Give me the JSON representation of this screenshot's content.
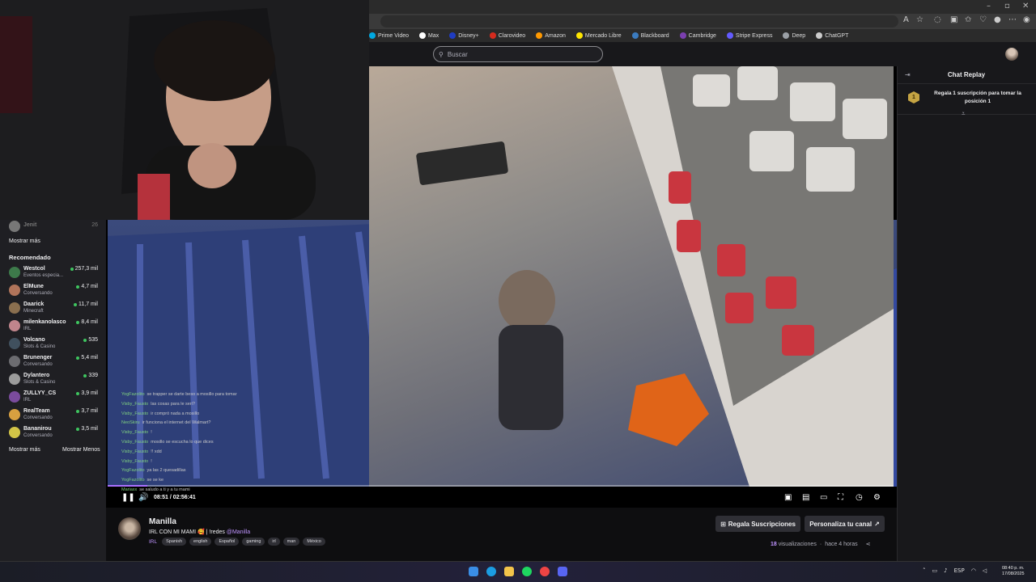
{
  "search": {
    "placeholder": "Buscar"
  },
  "bookmarks": [
    {
      "label": "Prime Video",
      "color": "#00a8e1"
    },
    {
      "label": "Max",
      "color": "#ffffff"
    },
    {
      "label": "Disney+",
      "color": "#1f3cc2"
    },
    {
      "label": "Clarovideo",
      "color": "#d52b1e"
    },
    {
      "label": "Amazon",
      "color": "#ff9900"
    },
    {
      "label": "Mercado Libre",
      "color": "#ffe600"
    },
    {
      "label": "Blackboard",
      "color": "#3b7bbf"
    },
    {
      "label": "Cambridge",
      "color": "#7b3fb0"
    },
    {
      "label": "Stripe Express",
      "color": "#635bff"
    },
    {
      "label": "Deep",
      "color": "#9ba0a6"
    },
    {
      "label": "ChatGPT",
      "color": "#cccccc"
    }
  ],
  "sidebar": {
    "top_item": {
      "name": "Jenit",
      "live": "26"
    },
    "show_more_1": "Mostrar más",
    "recommended_heading": "Recomendado",
    "channels": [
      {
        "name": "Westcol",
        "category": "Eventos especia...",
        "viewers": "257,3 mil",
        "color": "#3d7a4a"
      },
      {
        "name": "ElMune",
        "category": "Conversando",
        "viewers": "4,7 mil",
        "color": "#b0745a"
      },
      {
        "name": "Daarick",
        "category": "Minecraft",
        "viewers": "11,7 mil",
        "color": "#8a6f4f"
      },
      {
        "name": "milenkanolasco",
        "category": "IRL",
        "viewers": "8,4 mil",
        "color": "#c0858c"
      },
      {
        "name": "Volcano",
        "category": "Slots & Casino",
        "viewers": "535",
        "color": "#40505e"
      },
      {
        "name": "Brunenger",
        "category": "Conversando",
        "viewers": "5,4 mil",
        "color": "#6c6c70"
      },
      {
        "name": "Dylantero",
        "category": "Slots & Casino",
        "viewers": "339",
        "color": "#9c9c9c"
      },
      {
        "name": "ZULLYY_CS",
        "category": "IRL",
        "viewers": "3,9 mil",
        "color": "#7a4b9c"
      },
      {
        "name": "RealTeam",
        "category": "Conversando",
        "viewers": "3,7 mil",
        "color": "#d8a040"
      },
      {
        "name": "Bananirou",
        "category": "Conversando",
        "viewers": "3,5 mil",
        "color": "#d2c447"
      }
    ],
    "show_more_2": "Mostrar más",
    "show_less": "Mostrar Menos"
  },
  "player": {
    "time": "08:51 / 02:56:41",
    "progress_fraction": 0.05,
    "chat_overlay": [
      {
        "user": "YogFazolito",
        "msg": "se trapper se darte beso a mosillo para tomar"
      },
      {
        "user": "Visby_Fausto",
        "msg": "las cosas para le seri?"
      },
      {
        "user": "Visby_Fausto",
        "msg": "ir compró nada a mosillo"
      },
      {
        "user": "NeoSkiru",
        "msg": "ir funciona el internet del Walmart?"
      },
      {
        "user": "Visby_Fausto",
        "msg": "!"
      },
      {
        "user": "Visby_Fausto",
        "msg": "mosillo se escucha lo que dices"
      },
      {
        "user": "Visby_Fausto",
        "msg": "!! xdd"
      },
      {
        "user": "Visby_Fausto",
        "msg": "!"
      },
      {
        "user": "YogFazolito",
        "msg": "ya las 2 quesadillas"
      },
      {
        "user": "YogFazolito",
        "msg": "se se ke"
      },
      {
        "user": "Mariaxx",
        "msg": "se saludo a ti y a tu mami"
      }
    ]
  },
  "chat": {
    "title": "Chat Replay",
    "gift_badge": "1",
    "gift_text": "Regala 1 suscripción para tomar la posición 1"
  },
  "stream": {
    "streamer": "Manilla",
    "title_prefix": "IRL CON MI MAMI 🥰 | !redes ",
    "title_mention": "@Manilla",
    "category": "IRL",
    "tags": [
      "Spanish",
      "english",
      "Español",
      "gaming",
      "irl",
      "man",
      "México"
    ],
    "gift_button": "Regala Suscripciones",
    "customize_button": "Personaliza tu canal",
    "views_count": "18",
    "views_label": "visualizaciones",
    "separator": "·",
    "ago": "hace 4 horas"
  },
  "taskbar": {
    "lang": "ESP",
    "time": "08:40 p. m.",
    "date": "17/08/2025"
  }
}
